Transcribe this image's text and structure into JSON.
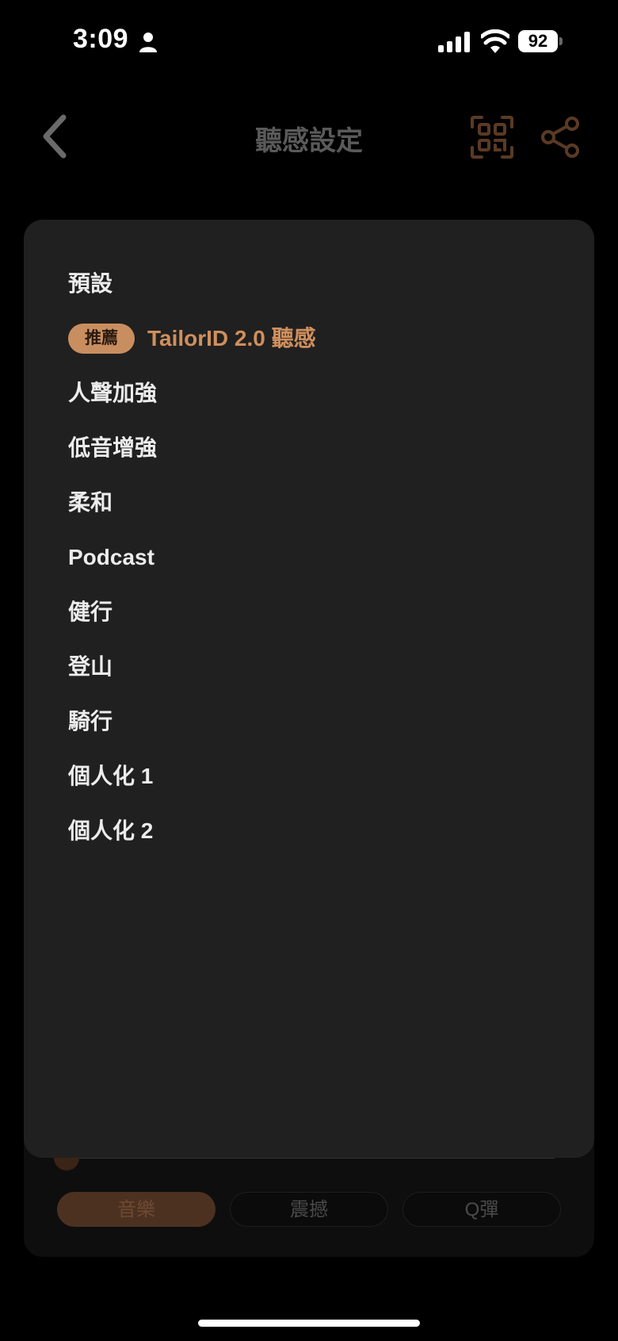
{
  "status_bar": {
    "time": "3:09",
    "battery": "92"
  },
  "header": {
    "title": "聽感設定"
  },
  "presets": {
    "default": "預設",
    "recommended": {
      "badge": "推薦",
      "label": "TailorID 2.0 聽感"
    },
    "items": [
      "人聲加強",
      "低音增強",
      "柔和",
      "Podcast",
      "健行",
      "登山",
      "騎行",
      "個人化 1",
      "個人化 2"
    ]
  },
  "mode_tabs": {
    "active_index": 0,
    "items": [
      "音樂",
      "震撼",
      "Q彈"
    ]
  },
  "colors": {
    "accent": "#d08f5c",
    "badge_bg": "#c98e5f",
    "sheet_bg": "#202020",
    "icon_brown": "#5a3a24"
  }
}
